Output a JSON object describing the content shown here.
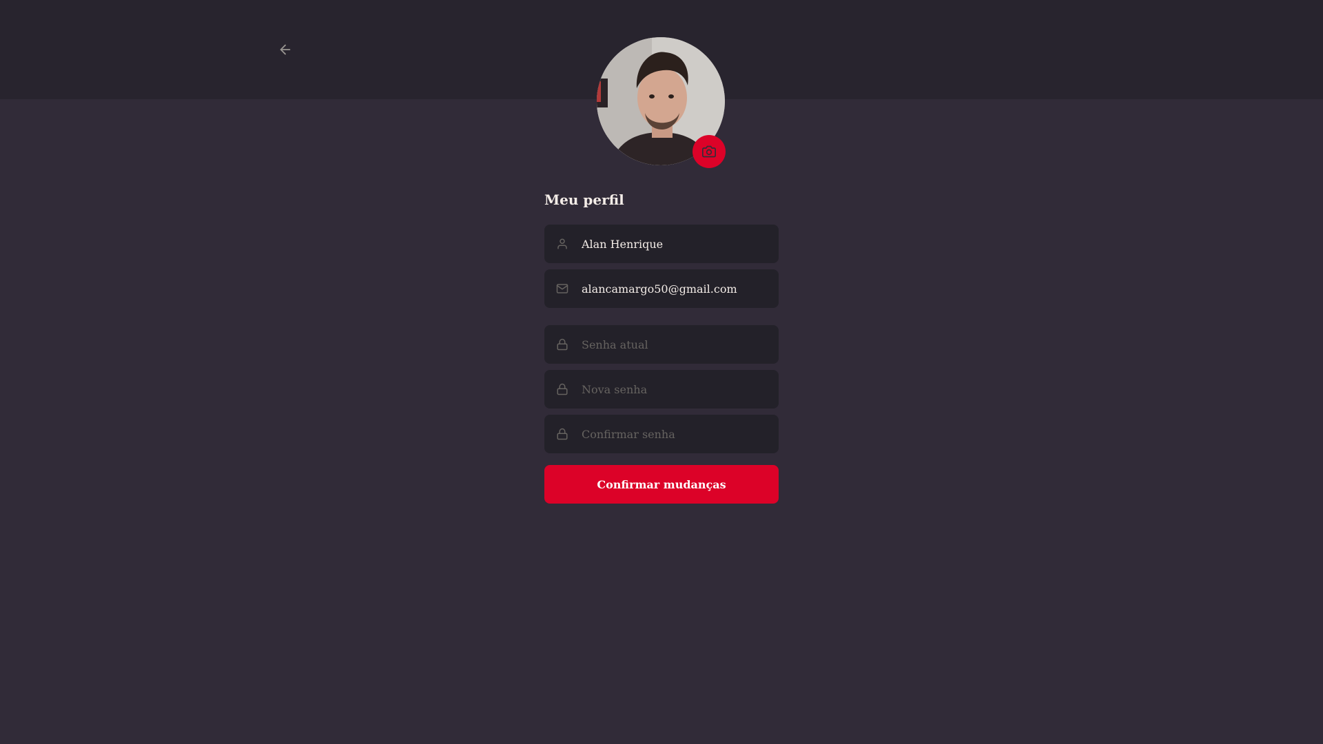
{
  "header": {
    "back_icon": "arrow-left-icon"
  },
  "avatar": {
    "camera_icon": "camera-icon"
  },
  "profile": {
    "title": "Meu perfil",
    "name_value": "Alan Henrique",
    "email_value": "alancamargo50@gmail.com",
    "old_password_placeholder": "Senha atual",
    "new_password_placeholder": "Nova senha",
    "confirm_password_placeholder": "Confirmar senha",
    "submit_label": "Confirmar mudanças"
  },
  "colors": {
    "background": "#312b38",
    "header": "#28242e",
    "input_background": "#232129",
    "accent": "#dc0228",
    "text": "#f4ede8",
    "placeholder": "#666360"
  }
}
